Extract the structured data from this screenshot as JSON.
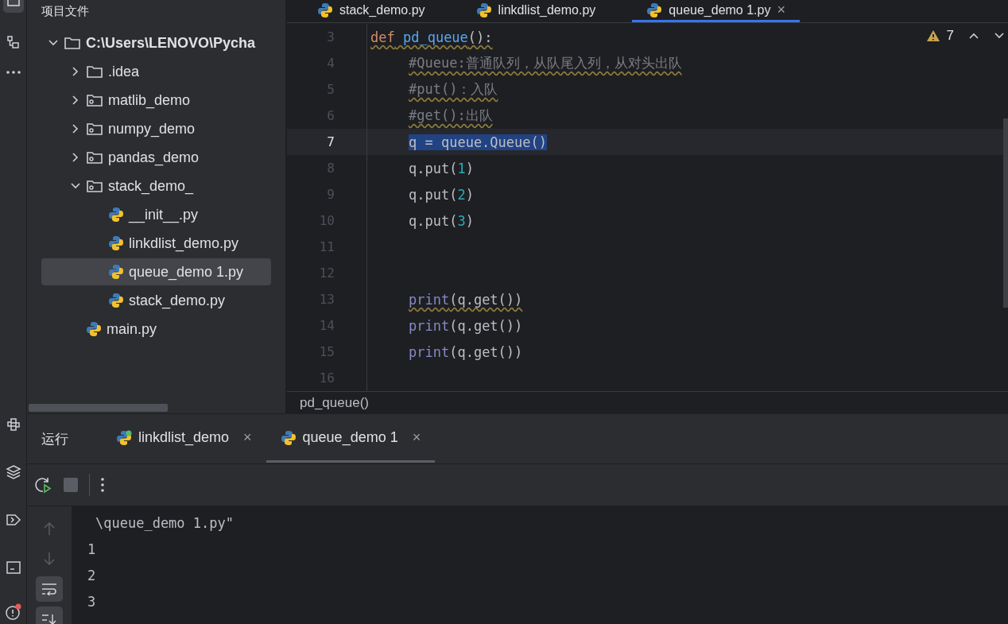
{
  "project_panel": {
    "title": "项目文件",
    "tree": [
      {
        "label": "C:\\Users\\LENOVO\\Pycha",
        "kind": "folder",
        "expanded": true,
        "selected": false,
        "children": [
          {
            "label": ".idea",
            "kind": "folder",
            "expanded": false,
            "selected": false
          },
          {
            "label": "matlib_demo",
            "kind": "package",
            "expanded": false,
            "selected": false
          },
          {
            "label": "numpy_demo",
            "kind": "package",
            "expanded": false,
            "selected": false
          },
          {
            "label": "pandas_demo",
            "kind": "package",
            "expanded": false,
            "selected": false
          },
          {
            "label": "stack_demo_",
            "kind": "package",
            "expanded": true,
            "selected": false,
            "children": [
              {
                "label": "__init__.py",
                "kind": "python",
                "selected": false
              },
              {
                "label": "linkdlist_demo.py",
                "kind": "python",
                "selected": false
              },
              {
                "label": "queue_demo 1.py",
                "kind": "python",
                "selected": true
              },
              {
                "label": "stack_demo.py",
                "kind": "python",
                "selected": false
              }
            ]
          },
          {
            "label": "main.py",
            "kind": "python",
            "selected": false
          }
        ]
      }
    ]
  },
  "editor_tabs": [
    {
      "label": "stack_demo.py",
      "selected": false
    },
    {
      "label": "linkdlist_demo.py",
      "selected": false
    },
    {
      "label": "queue_demo 1.py",
      "selected": true,
      "close": "×"
    }
  ],
  "inspections": {
    "warnings": "7"
  },
  "code_lines": [
    {
      "number": "3",
      "highlighted": false,
      "warned": true,
      "tokens": [
        {
          "text": "def",
          "kind": "keyword"
        },
        {
          "text": " pd_queue",
          "kind": "function"
        },
        {
          "text": "():",
          "kind": "plain"
        }
      ],
      "children": [
        {
          "number": "4",
          "highlighted": false,
          "warned": true,
          "tokens": [
            {
              "text": "#Queue:普通队列，从队尾入列，从对头出队",
              "kind": "comment"
            }
          ]
        },
        {
          "number": "5",
          "highlighted": false,
          "warned": true,
          "tokens": [
            {
              "text": "#put()：入队",
              "kind": "comment"
            }
          ]
        },
        {
          "number": "6",
          "highlighted": false,
          "warned": true,
          "tokens": [
            {
              "text": "#get():出队",
              "kind": "comment"
            }
          ]
        },
        {
          "number": "7",
          "highlighted": true,
          "warned": false,
          "tokens": [
            {
              "text": "q = queue.Queue()",
              "kind": "plain"
            }
          ]
        },
        {
          "number": "8",
          "highlighted": false,
          "warned": false,
          "tokens": [
            {
              "text": "q.put(",
              "kind": "plain"
            },
            {
              "text": "1",
              "kind": "number"
            },
            {
              "text": ")",
              "kind": "plain"
            }
          ]
        },
        {
          "number": "9",
          "highlighted": false,
          "warned": false,
          "tokens": [
            {
              "text": "q.put(",
              "kind": "plain"
            },
            {
              "text": "2",
              "kind": "number"
            },
            {
              "text": ")",
              "kind": "plain"
            }
          ]
        },
        {
          "number": "10",
          "highlighted": false,
          "warned": false,
          "tokens": [
            {
              "text": "q.put(",
              "kind": "plain"
            },
            {
              "text": "3",
              "kind": "number"
            },
            {
              "text": ")",
              "kind": "plain"
            }
          ]
        },
        {
          "number": "11"
        },
        {
          "number": "12"
        },
        {
          "number": "13",
          "highlighted": false,
          "warned": true,
          "tokens": [
            {
              "text": "print",
              "kind": "builtin"
            },
            {
              "text": "(q.get())",
              "kind": "plain"
            }
          ]
        },
        {
          "number": "14",
          "highlighted": false,
          "warned": false,
          "tokens": [
            {
              "text": "print",
              "kind": "builtin"
            },
            {
              "text": "(q.get())",
              "kind": "plain"
            }
          ]
        },
        {
          "number": "15",
          "highlighted": false,
          "warned": false,
          "tokens": [
            {
              "text": "print",
              "kind": "builtin"
            },
            {
              "text": "(q.get())",
              "kind": "plain"
            }
          ]
        }
      ]
    },
    {
      "number": "16"
    }
  ],
  "breadcrumb": "pd_queue()",
  "run_panel": {
    "title": "运行",
    "tabs": [
      {
        "label": "linkdlist_demo",
        "selected": false,
        "running": true,
        "close": "×"
      },
      {
        "label": "queue_demo 1",
        "selected": true,
        "running": false,
        "close": "×"
      }
    ],
    "output": [
      "\\queue_demo 1.py\"",
      "1",
      "2",
      "3"
    ],
    "soft_wrap": true
  }
}
